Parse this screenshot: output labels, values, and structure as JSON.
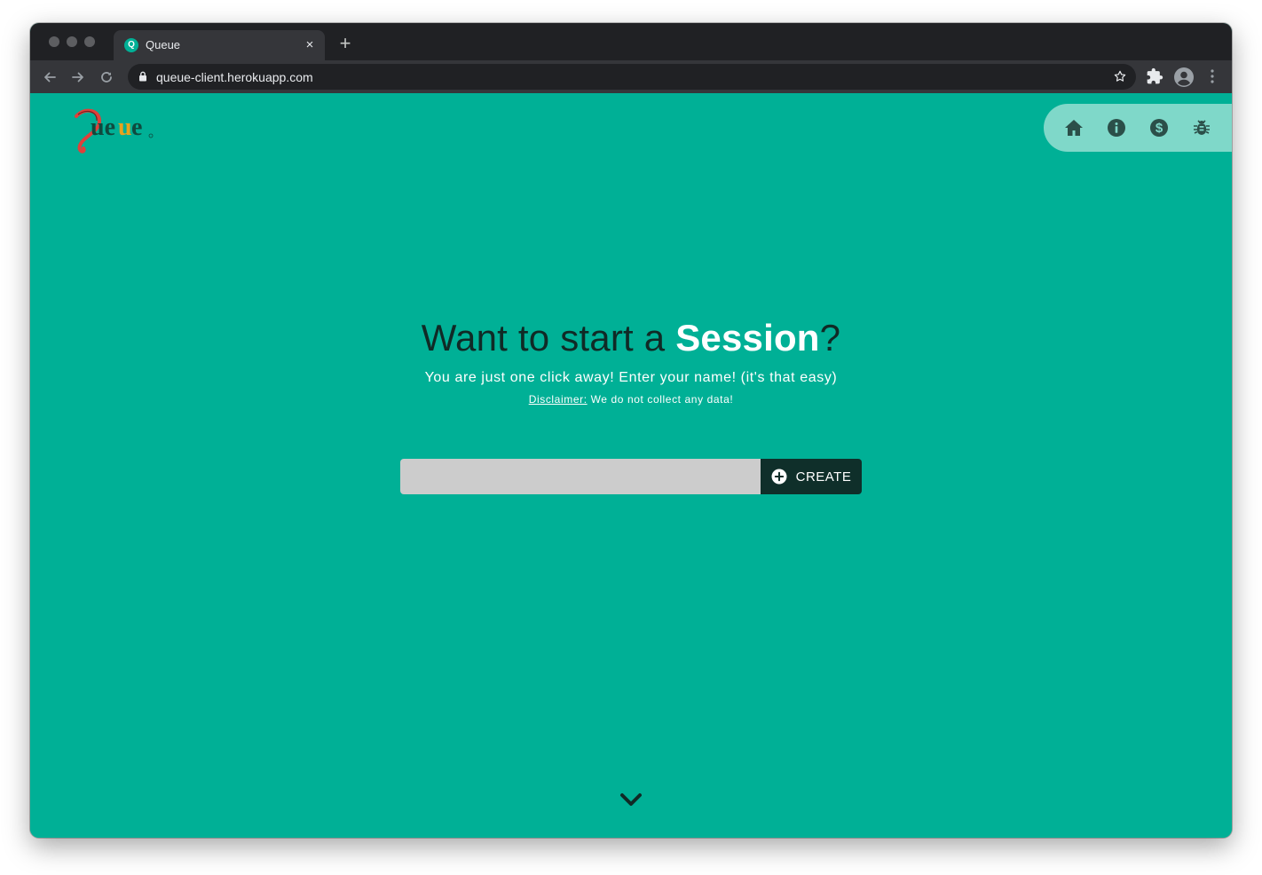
{
  "browser": {
    "tab_title": "Queue",
    "tab_favicon_glyph": "Q",
    "new_tab_label": "+",
    "close_tab_label": "×",
    "url": "queue-client.herokuapp.com"
  },
  "header": {
    "logo_text": "Queue",
    "nav_items": [
      "home-icon",
      "info-icon",
      "dollar-icon",
      "bug-icon"
    ]
  },
  "hero": {
    "headline_prefix": "Want to start a ",
    "headline_strong": "Session",
    "headline_suffix": "?",
    "subline": "You are just one click away! Enter your name! (it's that easy)",
    "disclaimer_label": "Disclaimer:",
    "disclaimer_text": " We do not collect any data!"
  },
  "form": {
    "name_value": "",
    "name_placeholder": "",
    "create_label": "CREATE"
  },
  "colors": {
    "page_bg": "#00b096",
    "nav_pill": "#7fd8c9",
    "button_dark": "#0f2f2a",
    "input_bg": "#cccccc"
  }
}
